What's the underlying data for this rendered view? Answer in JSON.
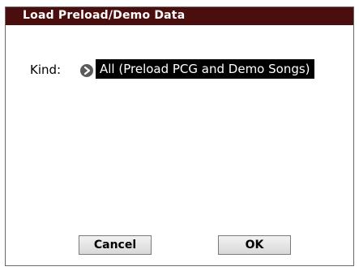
{
  "dialog": {
    "title": "Load Preload/Demo Data",
    "kind_label": "Kind:",
    "kind_value": "All (Preload PCG and Demo Songs)",
    "arrow_icon": "arrow-right-circle-icon",
    "cancel_label": "Cancel",
    "ok_label": "OK"
  },
  "colors": {
    "titlebar": "#4a0e0e",
    "selection_bg": "#000000",
    "selection_text": "#ffffff"
  }
}
